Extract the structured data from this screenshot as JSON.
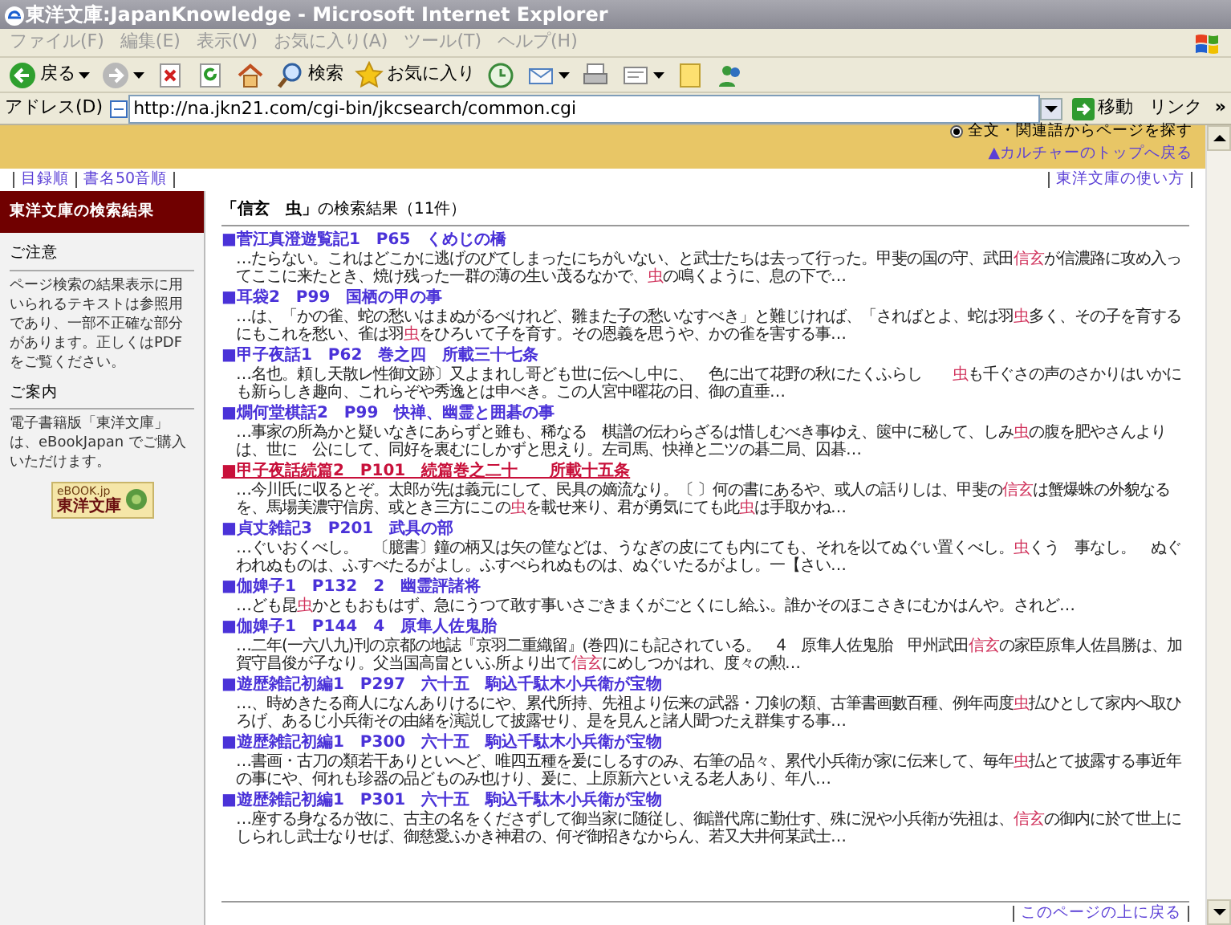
{
  "window": {
    "title": "東洋文庫:JapanKnowledge - Microsoft Internet Explorer",
    "active": false
  },
  "menu": [
    "ファイル(F)",
    "編集(E)",
    "表示(V)",
    "お気に入り(A)",
    "ツール(T)",
    "ヘルプ(H)"
  ],
  "toolbar": [
    {
      "kind": "back",
      "label": "戻る",
      "dropdown": true
    },
    {
      "kind": "forward",
      "dropdown": true
    },
    {
      "kind": "stop",
      "dropdown": false
    },
    {
      "kind": "refresh",
      "dropdown": false
    },
    {
      "kind": "home",
      "dropdown": false
    },
    {
      "kind": "search",
      "label": "検索",
      "dropdown": false
    },
    {
      "kind": "favorites",
      "label": "お気に入り",
      "dropdown": false
    },
    {
      "kind": "history",
      "dropdown": false
    },
    {
      "kind": "mail",
      "dropdown": true
    },
    {
      "kind": "print",
      "dropdown": false
    },
    {
      "kind": "edit",
      "dropdown": true
    },
    {
      "kind": "note",
      "dropdown": false
    },
    {
      "kind": "messenger",
      "dropdown": false
    }
  ],
  "address_bar": {
    "label": "アドレス(D)",
    "url": "http://na.jkn21.com/cgi-bin/jkcsearch/common.cgi",
    "go": "移動",
    "links": "リンク",
    "more": "»"
  },
  "search_options": [
    {
      "label": "全文・関連語からページを探す",
      "selected": true
    }
  ],
  "culture_link": "▲カルチャーのトップへ戻る",
  "top_links": [
    "目録順",
    "書名50音順"
  ],
  "help_link": "東洋文庫の使い方",
  "sidebar": {
    "header": "東洋文庫の検索結果",
    "sections": [
      {
        "heading": "ご注意",
        "text": "ページ検索の結果表示に用いられるテキストは参照用であり、一部不正確な部分があります。正しくはPDFをご覧ください。"
      },
      {
        "heading": "ご案内",
        "text": "電子書籍版「東洋文庫」は、eBookJapan でご購入いただけます。"
      }
    ],
    "logo": {
      "line1": "eBOOK.jp",
      "line2": "東洋文庫"
    }
  },
  "results_heading": "**「信玄　虫」**の検索結果（11件）",
  "results": [
    {
      "title": "■菅江真澄遊覧記1　P65　くめじの橋",
      "active": false,
      "snippet": [
        {
          "text": "…たらない。これはどこかに逃げのびてしまったにちがいない、と武士たちは去って行った。甲斐の国の守、武田",
          "hit": false
        },
        {
          "text": "信玄",
          "hit": true
        },
        {
          "text": "が信濃路に攻め入ってここに来たとき、焼け残った一群の薄の生い茂るなかで、",
          "hit": false
        },
        {
          "text": "虫",
          "hit": true
        },
        {
          "text": "の鳴くように、息の下で…",
          "hit": false
        }
      ]
    },
    {
      "title": "■耳袋2　P99　国栖の甲の事",
      "active": false,
      "snippet": [
        {
          "text": "…は、「かの雀、蛇の愁いはまぬがるべけれど、雛また子の愁いなすべき」と難じければ、「さればとよ、蛇は羽",
          "hit": false
        },
        {
          "text": "虫",
          "hit": true
        },
        {
          "text": "多く、その子を育するにもこれを愁い、雀は羽",
          "hit": false
        },
        {
          "text": "虫",
          "hit": true
        },
        {
          "text": "をひろいて子を育す。その恩義を思うや、かの雀を害する事…",
          "hit": false
        }
      ]
    },
    {
      "title": "■甲子夜話1　P62　巻之四　所載三十七条",
      "active": false,
      "snippet": [
        {
          "text": "…名也。頼し天散レ性御文跡〕又よまれし哥ども世に伝へし中に、　色に出て花野の秋にたくふらし　　",
          "hit": false
        },
        {
          "text": "虫",
          "hit": true
        },
        {
          "text": "も千ぐさの声のさかりはいかにも新らしき趣向、これらぞや秀逸とは申べき。この人宮中曜花の日、御の直垂…",
          "hit": false
        }
      ]
    },
    {
      "title": "■燗何堂棋話2　P99　快禅、幽霊と囲碁の事",
      "active": false,
      "snippet": [
        {
          "text": "…事家の所為かと疑いなきにあらずと雖も、稀なる　棋譜の伝わらざるは惜しむべき事ゆえ、篋中に秘して、しみ",
          "hit": false
        },
        {
          "text": "虫",
          "hit": true
        },
        {
          "text": "の腹を肥やさんよりは、世に　公にして、同好を裏むにしかずと思えり。左司馬、快禅と二ツの碁二局、囚碁…",
          "hit": false
        }
      ]
    },
    {
      "title": "■甲子夜話続篇2　P101　続篇巻之二十　　所載十五条",
      "active": true,
      "snippet": [
        {
          "text": "…今川氏に収るとぞ。太郎が先は義元にして、民具の嫡流なり。〔 〕何の書にあるや、或人の話りしは、甲斐の",
          "hit": false
        },
        {
          "text": "信玄",
          "hit": true
        },
        {
          "text": "は蟹爆蛛の外貌なるを、馬場美濃守信房、或とき三方にこの",
          "hit": false
        },
        {
          "text": "虫",
          "hit": true
        },
        {
          "text": "を載せ来り、君が勇気にても此",
          "hit": false
        },
        {
          "text": "虫",
          "hit": true
        },
        {
          "text": "は手取かね…",
          "hit": false
        }
      ]
    },
    {
      "title": "■貞丈雑記3　P201　武具の部",
      "active": false,
      "snippet": [
        {
          "text": "…ぐいおくべし。　〔臆書〕鐘の柄又は矢の筐などは、うなぎの皮にても内にても、それを以てぬぐい置くべし。",
          "hit": false
        },
        {
          "text": "虫",
          "hit": true
        },
        {
          "text": "くう　事なし。　ぬぐわれぬものは、ふすべたるがよし。ふすべられぬものは、ぬぐいたるがよし。一【さい…",
          "hit": false
        }
      ]
    },
    {
      "title": "■伽婢子1　P132　2　幽霊評諸将",
      "active": false,
      "snippet": [
        {
          "text": "…ども昆",
          "hit": false
        },
        {
          "text": "虫",
          "hit": true
        },
        {
          "text": "かともおもはず、急にうつて敢す事いさごきまくがごとくにし給ふ。誰かそのほこさきにむかはんや。されど…",
          "hit": false
        }
      ]
    },
    {
      "title": "■伽婢子1　P144　4　原隼人佐鬼胎",
      "active": false,
      "snippet": [
        {
          "text": "…二年(一六八九)刊の京都の地誌『京羽二重織留』(巻四)にも記されている。　4　原隼人佐鬼胎　甲州武田",
          "hit": false
        },
        {
          "text": "信玄",
          "hit": true
        },
        {
          "text": "の家臣原隼人佐昌勝は、加賀守昌俊が子なり。父当国高畠といふ所より出て",
          "hit": false
        },
        {
          "text": "信玄",
          "hit": true
        },
        {
          "text": "にめしつかはれ、度々の勲…",
          "hit": false
        }
      ]
    },
    {
      "title": "■遊歴雑記初編1　P297　六十五　駒込千駄木小兵衛が宝物",
      "active": false,
      "snippet": [
        {
          "text": "…、時めきたる商人になんありけるにや、累代所持、先祖より伝来の武器・刀剣の類、古筆書画數百種、例年両度",
          "hit": false
        },
        {
          "text": "虫",
          "hit": true
        },
        {
          "text": "払ひとして家内へ取ひろげ、あるじ小兵衛その由緒を演説して披露せり、是を見んと諸人聞つたえ群集する事…",
          "hit": false
        }
      ]
    },
    {
      "title": "■遊歴雑記初編1　P300　六十五　駒込千駄木小兵衛が宝物",
      "active": false,
      "snippet": [
        {
          "text": "…書画・古刀の類若干ありといへど、唯四五種を爰にしるすのみ、右筆の品々、累代小兵衛が家に伝来して、毎年",
          "hit": false
        },
        {
          "text": "虫",
          "hit": true
        },
        {
          "text": "払とて披露する事近年の事にや、何れも珍器の品どものみ也けり、爰に、上原新六といえる老人あり、年八…",
          "hit": false
        }
      ]
    },
    {
      "title": "■遊歴雑記初編1　P301　六十五　駒込千駄木小兵衛が宝物",
      "active": false,
      "snippet": [
        {
          "text": "…座する身なるが故に、古主の名をくださずして御当家に随従し、御譜代席に勤仕す、殊に況や小兵衛が先祖は、",
          "hit": false
        },
        {
          "text": "信玄",
          "hit": true
        },
        {
          "text": "の御内に於て世上にしられし武士なりせば、御慈愛ふかき神君の、何ぞ御招きなからん、若又大井何某武士…",
          "hit": false
        }
      ]
    }
  ],
  "back_to_top": "このページの上に戻る"
}
